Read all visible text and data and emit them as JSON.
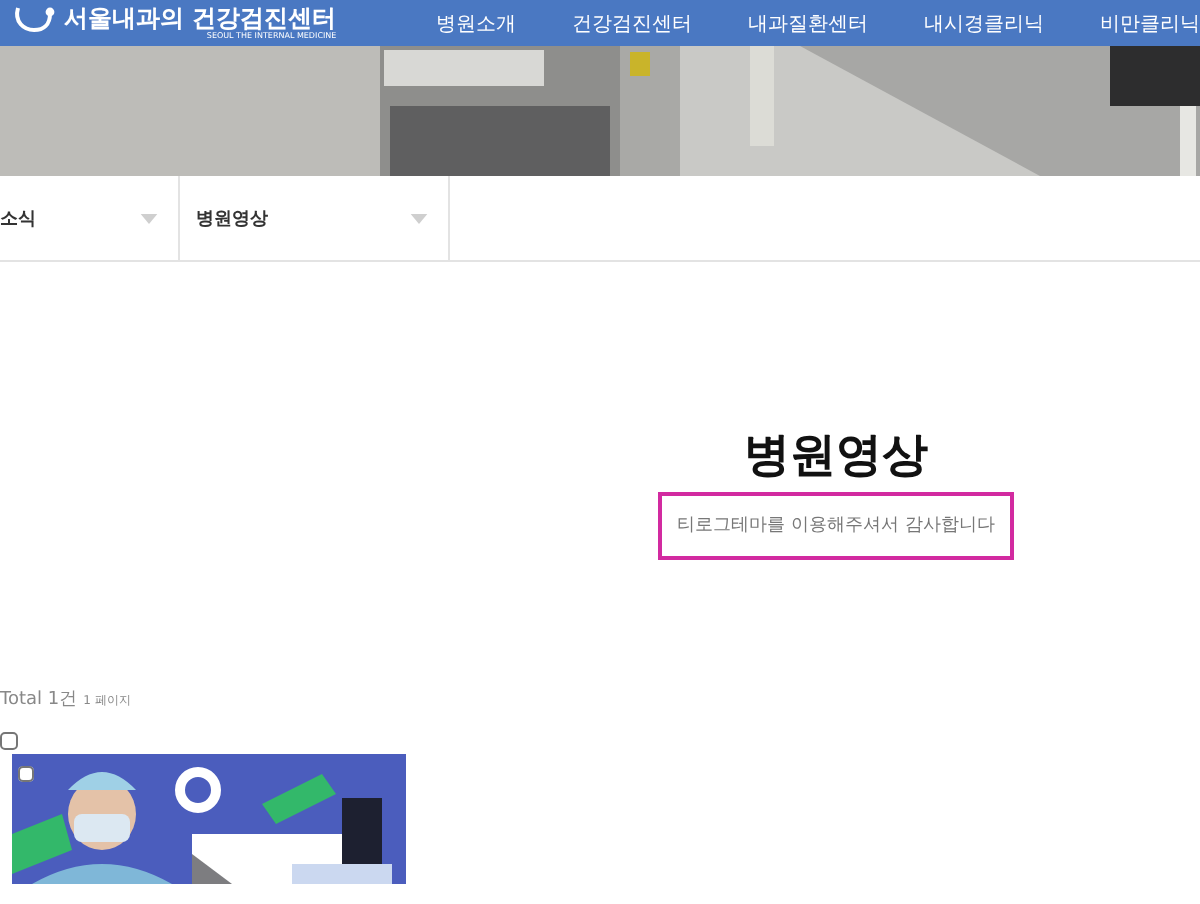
{
  "header": {
    "logo_title": "서울내과의 건강검진센터",
    "logo_subtitle": "SEOUL THE INTERNAL MEDICINE",
    "nav": [
      "병원소개",
      "건강검진센터",
      "내과질환센터",
      "내시경클리닉",
      "비만클리닉"
    ]
  },
  "subnav": [
    {
      "label": "소식"
    },
    {
      "label": "병원영상"
    }
  ],
  "page": {
    "title": "병원영상",
    "notice": "티로그테마를 이용해주셔서 감사합니다"
  },
  "list": {
    "total": "Total 1건",
    "pages": "1 페이지",
    "select_all": {
      "checked": false
    }
  }
}
